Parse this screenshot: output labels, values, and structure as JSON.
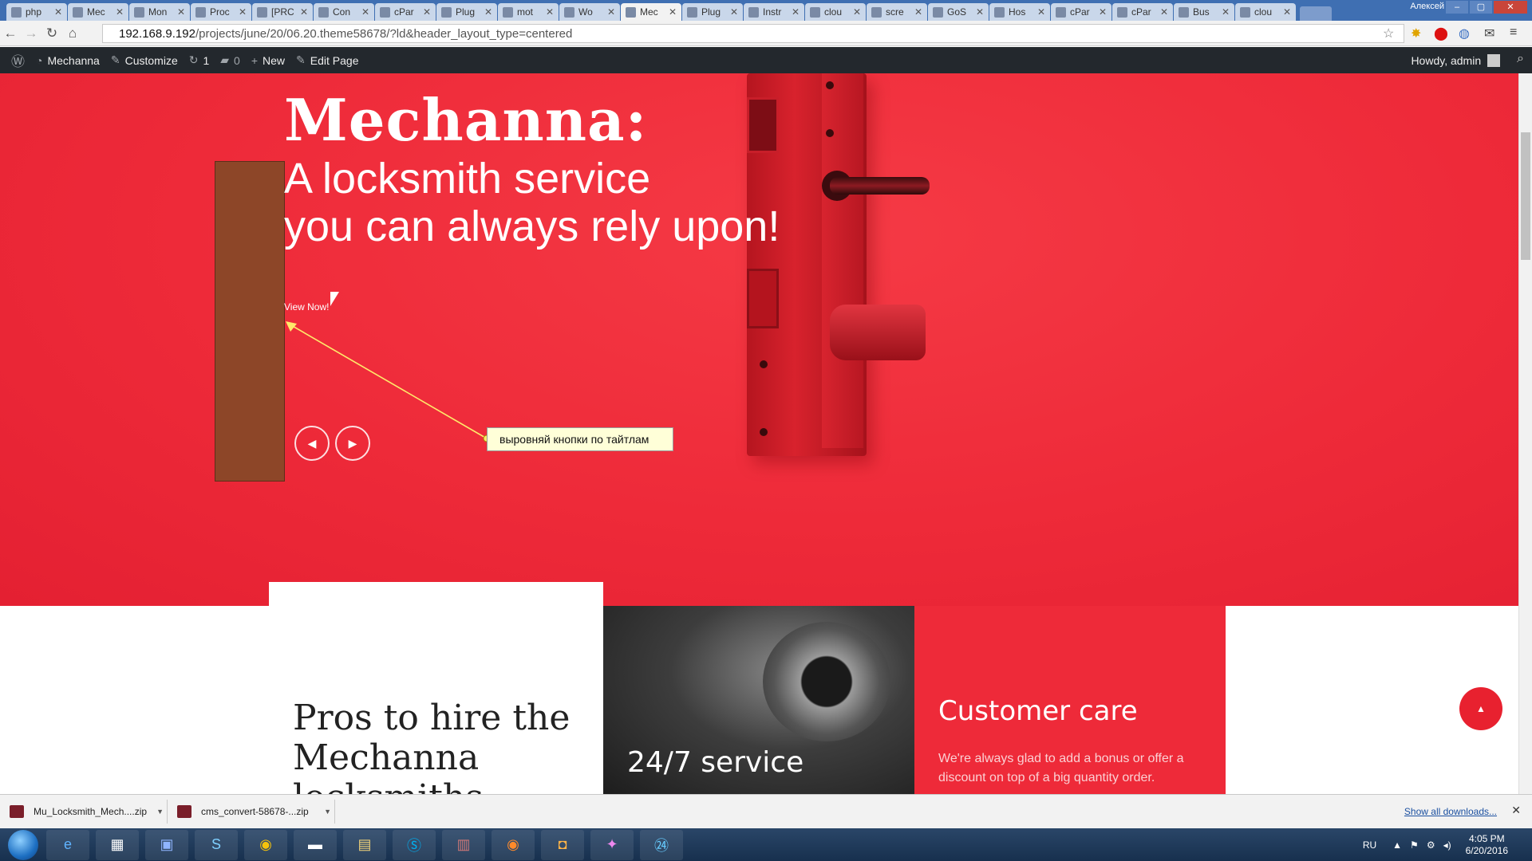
{
  "browser": {
    "tabs": [
      {
        "label": "php"
      },
      {
        "label": "Mec"
      },
      {
        "label": "Mon"
      },
      {
        "label": "Proc"
      },
      {
        "label": "[PRC"
      },
      {
        "label": "Con"
      },
      {
        "label": "cPar"
      },
      {
        "label": "Plug"
      },
      {
        "label": "mot"
      },
      {
        "label": "Wo"
      },
      {
        "label": "Mec",
        "active": true
      },
      {
        "label": "Plug"
      },
      {
        "label": "Instr"
      },
      {
        "label": "clou"
      },
      {
        "label": "scre"
      },
      {
        "label": "GoS"
      },
      {
        "label": "Hos"
      },
      {
        "label": "cPar"
      },
      {
        "label": "cPar"
      },
      {
        "label": "Bus"
      },
      {
        "label": "clou"
      }
    ],
    "window_user": "Алексей",
    "url_host": "192.168.9.192",
    "url_path": "/projects/june/20/06.20.theme58678/?ld&header_layout_type=centered"
  },
  "wp_admin_bar": {
    "site_name": "Mechanna",
    "customize": "Customize",
    "updates_count": "1",
    "comments_count": "0",
    "new": "New",
    "edit_page": "Edit Page",
    "howdy": "Howdy, admin"
  },
  "hero": {
    "title": "Mechanna:",
    "subtitle_line1": "A locksmith service",
    "subtitle_line2": "you can always rely upon!",
    "view_now": "View Now!",
    "annotation_note": "выровняй кнопки по тайтлам",
    "prev_arrow": "◀",
    "next_arrow": "▶"
  },
  "features": {
    "pros_title": "Pros to hire the Mechanna locksmiths",
    "service_title": "24/7 service",
    "care_title": "Customer care",
    "care_text": "We're always glad to add a bonus or offer a discount on top of a big quantity order."
  },
  "downloads": {
    "items": [
      {
        "name": "Mu_Locksmith_Mech....zip"
      },
      {
        "name": "cms_convert-58678-...zip"
      }
    ],
    "show_all": "Show all downloads..."
  },
  "taskbar": {
    "lang": "RU",
    "time": "4:05 PM",
    "date": "6/20/2016"
  },
  "colors": {
    "hero_red": "#ee2a39",
    "wp_bar": "#23282d",
    "note_bg": "#ffffd8"
  }
}
